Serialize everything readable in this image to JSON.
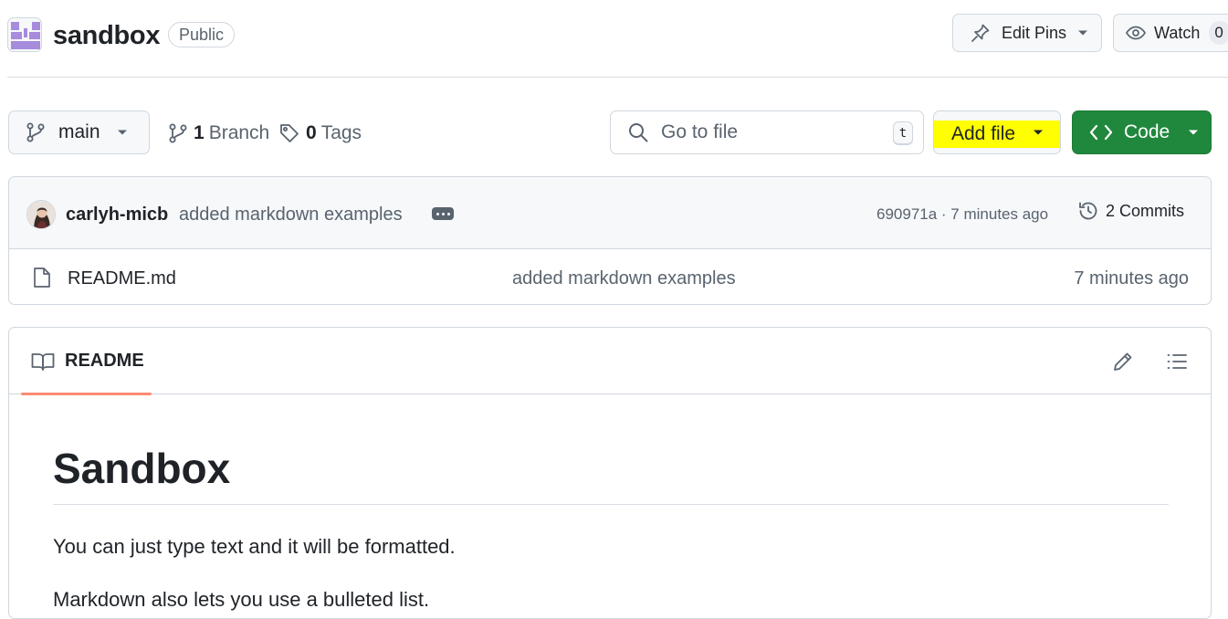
{
  "repo": {
    "name": "sandbox",
    "visibility": "Public",
    "avatar_icon": "identicon-icon",
    "avatar_color": "#a78bdc"
  },
  "header_actions": {
    "edit_pins_label": "Edit Pins",
    "watch_label": "Watch",
    "watch_count": "0"
  },
  "toolbar": {
    "branch": "main",
    "branch_count": "1",
    "branch_label": "Branch",
    "tag_count": "0",
    "tag_label": "Tags",
    "goto_placeholder": "Go to file",
    "goto_shortcut": "t",
    "add_file_label": "Add file",
    "add_file_highlight": "#ffff00",
    "code_label": "Code",
    "code_color": "#1f883d"
  },
  "latest_commit": {
    "author": "carlyh-micb",
    "message": "added markdown examples",
    "sha_time": "690971a · 7 minutes ago",
    "commits_label": "2 Commits"
  },
  "files": [
    {
      "name": "README.md",
      "message": "added markdown examples",
      "time": "7 minutes ago",
      "icon": "file-icon"
    }
  ],
  "readme": {
    "tab_label": "README",
    "heading": "Sandbox",
    "paragraphs": [
      "You can just type text and it will be formatted.",
      "Markdown also lets you use a bulleted list."
    ]
  }
}
